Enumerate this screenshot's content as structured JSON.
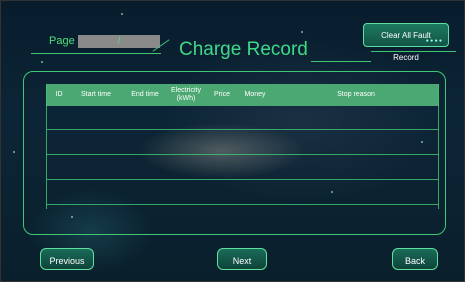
{
  "page": {
    "label": "Page",
    "current": "",
    "separator": "/"
  },
  "title": "Charge Record",
  "buttons": {
    "clear_all": "Clear All Fault Record",
    "previous": "Previous",
    "next": "Next",
    "back": "Back"
  },
  "table": {
    "columns": [
      "ID",
      "Start time",
      "End time",
      "Electricity (kWh)",
      "Price",
      "Money",
      "Stop reason"
    ],
    "rows": []
  },
  "colors": {
    "accent": "#3fd98a",
    "header_bg": "#4ba873",
    "background": "#0c2536"
  }
}
